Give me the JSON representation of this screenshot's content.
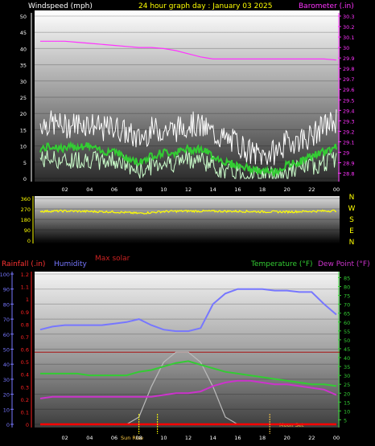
{
  "header": {
    "wind_label": "Windspeed (mph)",
    "title": "24 hour graph day : January 03 2025",
    "baro_label": "Barometer (.in)"
  },
  "colors": {
    "baro": "#ff33ff",
    "wind_avg": "#33cc33",
    "wind_gust": "#ffffff",
    "wind_low": "#ccffcc",
    "direction": "#ffff00",
    "humidity": "#7777ff",
    "temperature": "#33cc33",
    "dewpoint": "#cc33cc",
    "solar": "#bbbbbb",
    "rain_axis": "#ff2222",
    "temp_axis": "#33cc33",
    "max_solar_line": "#aa1111",
    "rain_line": "#ff0000",
    "moon": "#ffcc44",
    "sun_tick": "#ffff00"
  },
  "x_ticks": [
    "02",
    "04",
    "06",
    "08",
    "10",
    "12",
    "14",
    "16",
    "18",
    "20",
    "22",
    "00"
  ],
  "wind_chart": {
    "type": "line",
    "y_ticks": [
      "0",
      "5",
      "10",
      "15",
      "20",
      "25",
      "30",
      "35",
      "40",
      "45",
      "50"
    ],
    "ylim": [
      0,
      50
    ],
    "baro_ticks": [
      "28.8",
      "28.9",
      "29",
      "29.1",
      "29.2",
      "29.3",
      "29.4",
      "29.5",
      "29.6",
      "29.7",
      "29.8",
      "29.9",
      "30",
      "30.1",
      "30.2",
      "30.3"
    ],
    "baro_lim": [
      28.75,
      30.3
    ],
    "x": [
      0,
      1,
      2,
      3,
      4,
      5,
      6,
      7,
      8,
      9,
      10,
      11,
      12,
      13,
      14,
      15,
      16,
      17,
      18,
      19,
      20,
      21,
      22,
      23,
      24
    ],
    "barometer": [
      30.06,
      30.06,
      30.06,
      30.05,
      30.04,
      30.03,
      30.02,
      30.01,
      30.0,
      30.0,
      29.99,
      29.97,
      29.94,
      29.91,
      29.89,
      29.89,
      29.89,
      29.89,
      29.89,
      29.89,
      29.89,
      29.89,
      29.89,
      29.89,
      29.88
    ],
    "wind_gust": [
      17,
      17,
      16,
      17,
      17,
      15,
      16,
      14,
      12,
      15,
      15,
      15,
      17,
      16,
      14,
      12,
      11,
      8,
      7,
      8,
      11,
      12,
      13,
      16,
      18
    ],
    "wind_avg": [
      9,
      10,
      9,
      10,
      10,
      8,
      9,
      6,
      5,
      7,
      8,
      8,
      9,
      9,
      7,
      5,
      4,
      3,
      2,
      2,
      4,
      5,
      7,
      8,
      10
    ],
    "wind_low": [
      6,
      6,
      5,
      6,
      6,
      5,
      6,
      4,
      2,
      4,
      5,
      5,
      6,
      6,
      4,
      2,
      2,
      1,
      1,
      1,
      2,
      3,
      4,
      5,
      6
    ]
  },
  "direction_chart": {
    "type": "line",
    "y_ticks": [
      "0",
      "90",
      "180",
      "270",
      "360"
    ],
    "compass": [
      "N",
      "W",
      "S",
      "E",
      "N"
    ],
    "ylim": [
      0,
      360
    ],
    "x": [
      0,
      2,
      4,
      6,
      8,
      10,
      12,
      14,
      16,
      18,
      20,
      22,
      24
    ],
    "direction": [
      250,
      252,
      248,
      245,
      232,
      248,
      252,
      250,
      250,
      246,
      245,
      250,
      255
    ]
  },
  "bottom_chart": {
    "type": "line",
    "labels": {
      "max_solar": "Max solar",
      "rainfall": "Rainfall (.in)",
      "humidity": "Humidity",
      "temperature": "Temperature (°F)",
      "dewpoint": "Dew Point (°F)",
      "sunrise": "Sun Rise",
      "moonset": "Moon Set"
    },
    "humidity_ticks": [
      "0",
      "10",
      "20",
      "30",
      "40",
      "50",
      "60",
      "70",
      "80",
      "90",
      "100"
    ],
    "rain_ticks": [
      "0",
      "0.1",
      "0.2",
      "0.3",
      "0.4",
      "0.5",
      "0.6",
      "0.7",
      "0.8",
      "0.9",
      "1",
      "1.1",
      "1.2"
    ],
    "temp_ticks": [
      "5",
      "10",
      "15",
      "20",
      "25",
      "30",
      "35",
      "40",
      "45",
      "50",
      "55",
      "60",
      "65",
      "70",
      "75",
      "80",
      "85"
    ],
    "humidity_lim": [
      0,
      100
    ],
    "rain_lim": [
      0,
      1.2
    ],
    "temp_lim": [
      2.5,
      87
    ],
    "x": [
      0,
      1,
      2,
      3,
      4,
      5,
      6,
      7,
      8,
      9,
      10,
      11,
      12,
      13,
      14,
      15,
      16,
      17,
      18,
      19,
      20,
      21,
      22,
      23,
      24
    ],
    "humidity": [
      63,
      65,
      66,
      66,
      66,
      66,
      67,
      68,
      70,
      66,
      63,
      62,
      62,
      64,
      80,
      87,
      90,
      90,
      90,
      89,
      89,
      88,
      88,
      80,
      73
    ],
    "temperature": [
      31,
      31,
      31,
      31,
      30,
      30,
      30,
      30,
      32,
      33,
      35,
      37,
      38,
      36,
      34,
      32,
      31,
      30,
      29,
      28,
      27,
      26,
      25,
      25,
      24
    ],
    "dewpoint": [
      17,
      18,
      18,
      18,
      18,
      18,
      18,
      18,
      18,
      18,
      19,
      20,
      20,
      21,
      24,
      26,
      27,
      27,
      26,
      25,
      25,
      24,
      23,
      22,
      19
    ],
    "solar_pct": [
      0,
      0,
      0,
      0,
      0,
      0,
      0,
      0,
      10,
      52,
      86,
      100,
      100,
      86,
      52,
      10,
      0,
      0,
      0,
      0,
      0,
      0,
      0,
      0,
      0
    ],
    "rain": [
      0,
      0,
      0,
      0,
      0,
      0,
      0,
      0,
      0,
      0,
      0,
      0,
      0,
      0,
      0,
      0,
      0,
      0,
      0,
      0,
      0,
      0,
      0,
      0,
      0
    ],
    "max_solar_level": 0.48,
    "sunrise_hour": 8.0,
    "moonset_hour": 18.6
  }
}
